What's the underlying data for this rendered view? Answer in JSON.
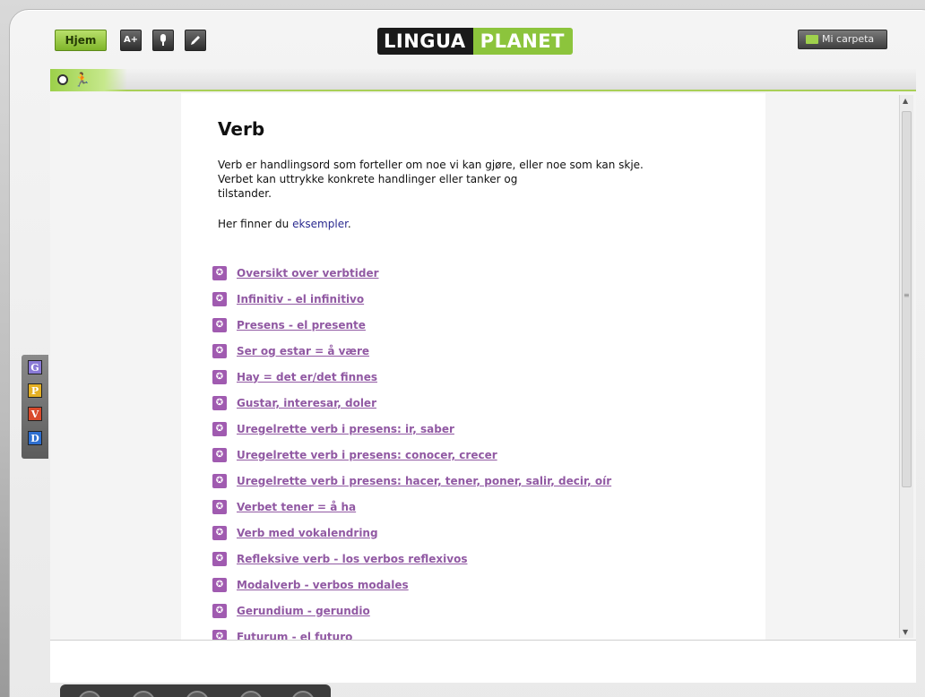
{
  "topbar": {
    "home_label": "Hjem",
    "font_size_label": "A+",
    "mic_icon": "microphone-icon",
    "pen_icon": "pen-icon",
    "logo_part1": "LINGUA",
    "logo_part2": "PLANET",
    "folder_label": "Mi carpeta"
  },
  "tabs": {
    "clock_icon": "clock-icon",
    "runner_icon": "running-person-icon"
  },
  "side_panel": {
    "buttons": [
      "G",
      "P",
      "V",
      "D"
    ]
  },
  "content": {
    "title": "Verb",
    "intro_line1": "Verb er handlingsord som forteller om noe vi kan gjøre, eller noe som kan skje.",
    "intro_line2": "Verbet kan uttrykke konkrete handlinger eller tanker og",
    "intro_line3": "tilstander.",
    "examples_prefix": "Her finner du ",
    "examples_link": "eksempler",
    "examples_suffix": ".",
    "topics": [
      "Oversikt over verbtider",
      "Infinitiv - el infinitivo",
      "Presens - el presente",
      "Ser og estar = å være",
      "Hay = det er/det finnes",
      "Gustar, interesar, doler",
      "Uregelrette verb i presens: ir, saber",
      "Uregelrette verb i presens: conocer, crecer",
      "Uregelrette verb i presens: hacer, tener, poner, salir, decir, oír",
      "Verbet tener = å ha",
      "Verb med vokalendring",
      "Refleksive verb - los verbos reflexivos",
      "Modalverb - verbos modales",
      "Gerundium - gerundio",
      "Futurum - el futuro"
    ]
  },
  "colors": {
    "accent_green": "#8cc43c",
    "topic_purple": "#9159a3"
  }
}
